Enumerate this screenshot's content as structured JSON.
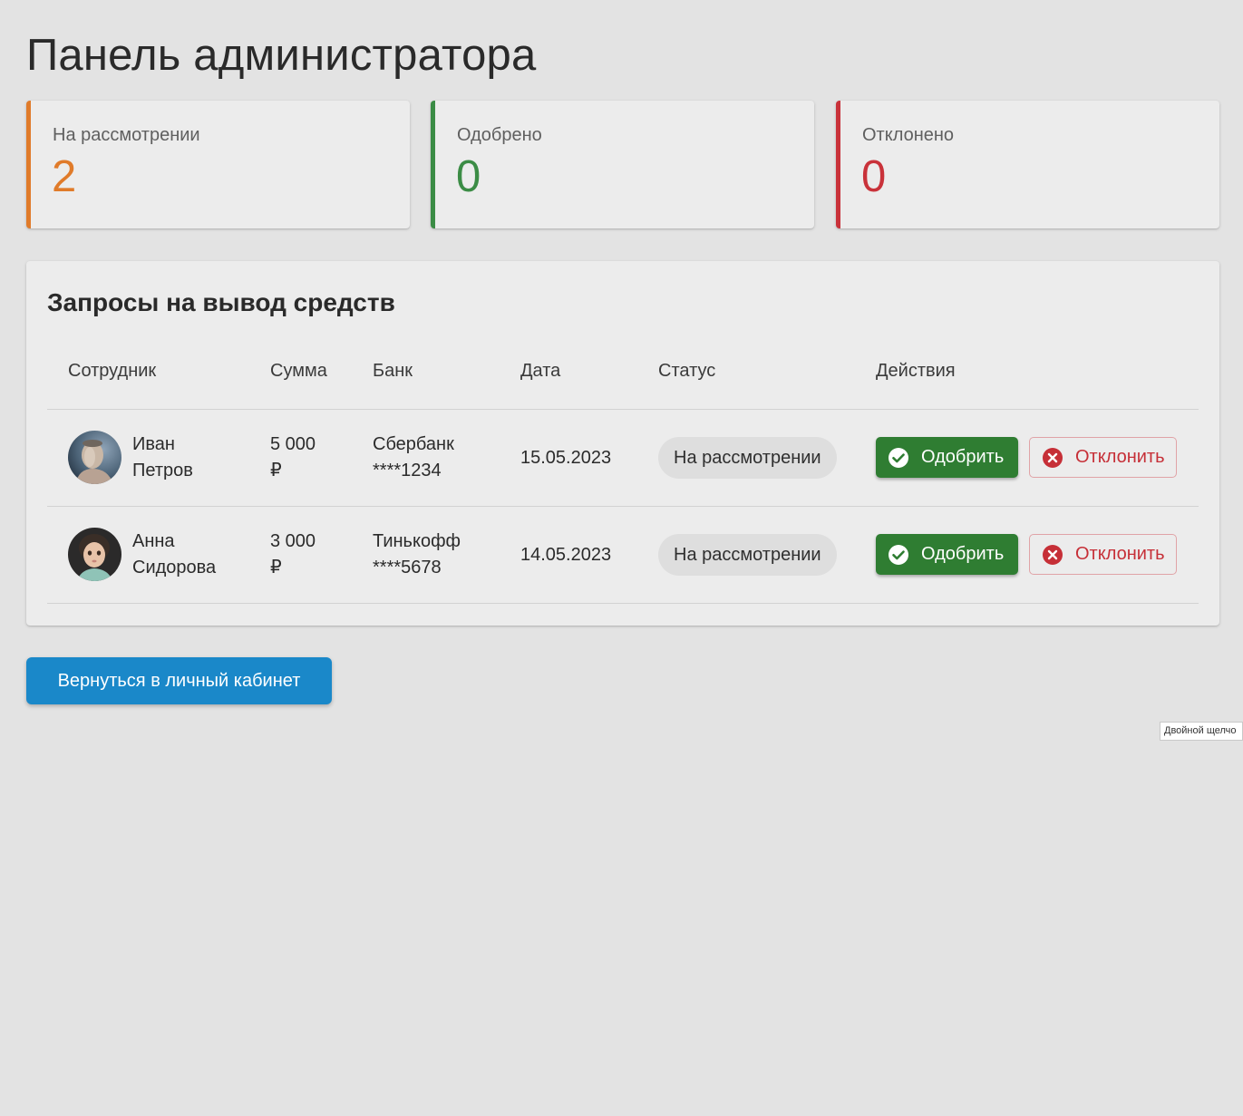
{
  "page": {
    "title": "Панель администратора"
  },
  "stats": [
    {
      "label": "На рассмотрении",
      "value": "2",
      "color": "#e07b2a"
    },
    {
      "label": "Одобрено",
      "value": "0",
      "color": "#3b8c45"
    },
    {
      "label": "Отклонено",
      "value": "0",
      "color": "#c9323a"
    }
  ],
  "requests": {
    "title": "Запросы на вывод средств",
    "columns": [
      "Сотрудник",
      "Сумма",
      "Банк",
      "Дата",
      "Статус",
      "Действия"
    ],
    "rows": [
      {
        "name_first": "Иван",
        "name_last": "Петров",
        "amount_value": "5 000",
        "currency": "₽",
        "bank_name": "Сбербанк",
        "bank_account": "****1234",
        "date": "15.05.2023",
        "status": "На рассмотрении",
        "approve_label": "Одобрить",
        "reject_label": "Отклонить"
      },
      {
        "name_first": "Анна",
        "name_last": "Сидорова",
        "amount_value": "3 000",
        "currency": "₽",
        "bank_name": "Тинькофф",
        "bank_account": "****5678",
        "date": "14.05.2023",
        "status": "На рассмотрении",
        "approve_label": "Одобрить",
        "reject_label": "Отклонить"
      }
    ]
  },
  "back_button_label": "Вернуться в личный кабинет",
  "tooltip_text": "Двойной щелчо",
  "icons": {
    "approve": "check-circle-icon",
    "reject": "x-circle-icon",
    "avatar": "avatar-photo"
  },
  "colors": {
    "approve_button": "#2f7d32",
    "reject_text": "#c62f37",
    "back_button": "#1a88c9"
  }
}
